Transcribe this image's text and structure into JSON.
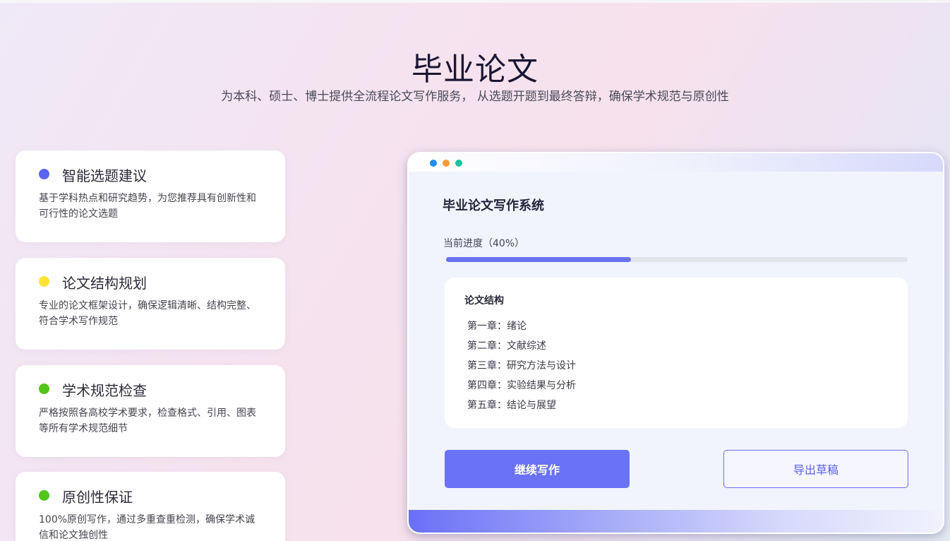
{
  "hero": {
    "title": "毕业论文",
    "subtitle": "为本科、硕士、博士提供全流程论文写作服务， 从选题开题到最终答辩，确保学术规范与原创性"
  },
  "features": [
    {
      "title": "智能选题建议",
      "desc": "基于学科热点和研究趋势，为您推荐具有创新性和可行性的论文选题",
      "dot_color": "#5b63f0",
      "icon": "blue-dot-icon"
    },
    {
      "title": "论文结构规划",
      "desc": "专业的论文框架设计，确保逻辑清晰、结构完整、符合学术写作规范",
      "dot_color": "#fce234",
      "icon": "yellow-dot-icon"
    },
    {
      "title": "学术规范检查",
      "desc": "严格按照各高校学术要求，检查格式、引用、图表等所有学术规范细节",
      "dot_color": "#52c41a",
      "icon": "green-dot-icon"
    },
    {
      "title": "原创性保证",
      "desc": "100%原创写作，通过多重查重检测，确保学术诚信和论文独创性",
      "dot_color": "#52c41a",
      "icon": "green-dot-icon"
    }
  ],
  "window": {
    "dots": [
      "#1f8ef0",
      "#f59a3c",
      "#18c49a"
    ],
    "title": "毕业论文写作系统",
    "progress_label": "当前进度（40%）",
    "progress": 0.4,
    "progress_color": "#6a72f0",
    "structure_heading": "论文结构",
    "chapters": [
      "第一章：绪论",
      "第二章：文献综述",
      "第三章：研究方法与设计",
      "第四章：实验结果与分析",
      "第五章：结论与展望"
    ],
    "continue_label": "继续写作",
    "export_label": "导出草稿"
  }
}
